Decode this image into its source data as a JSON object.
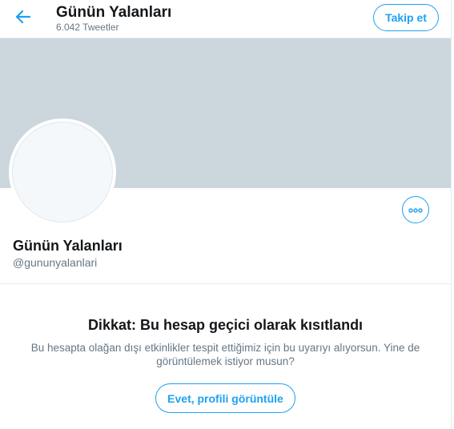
{
  "header": {
    "title": "Günün Yalanları",
    "tweet_count": "6.042 Tweetler",
    "follow_label": "Takip et",
    "back_icon": "arrow-left-icon"
  },
  "profile": {
    "name": "Günün Yalanları",
    "handle": "@gununyalanlari",
    "more_icon": "more-options-icon"
  },
  "warning": {
    "title": "Dikkat: Bu hesap geçici olarak kısıtlandı",
    "message": "Bu hesapta olağan dışı etkinlikler tespit ettiğimiz için bu uyarıyı alıyorsun. Yine de görüntülemek istiyor musun?",
    "button_label": "Evet, profili görüntüle"
  },
  "colors": {
    "accent": "#1da1f2",
    "banner": "#ccd6dd",
    "secondary_text": "#657786",
    "primary_text": "#14171a"
  }
}
